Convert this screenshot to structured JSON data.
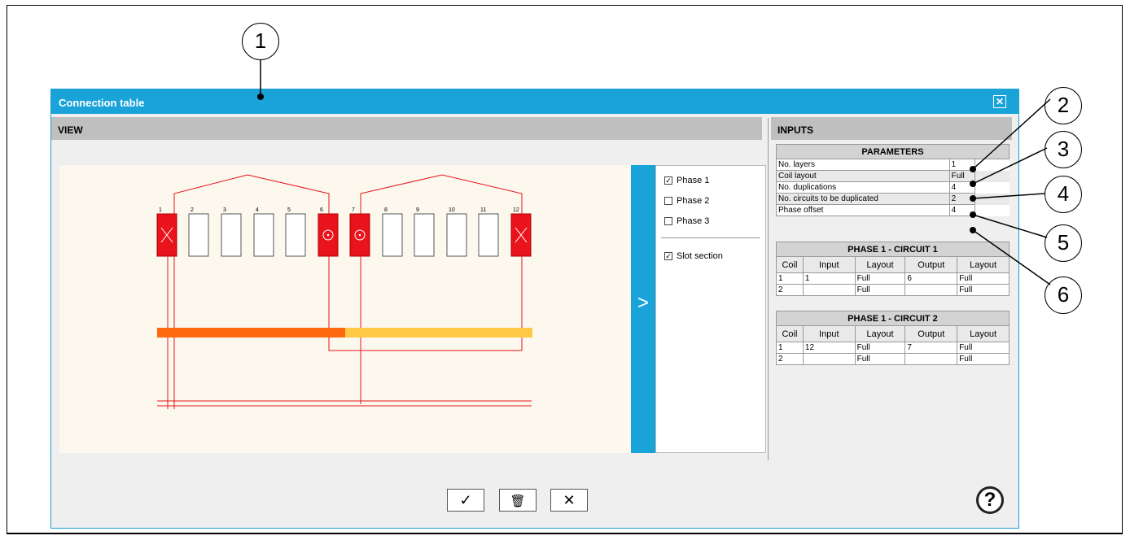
{
  "callouts": [
    "1",
    "2",
    "3",
    "4",
    "5",
    "6"
  ],
  "window": {
    "title": "Connection table",
    "close_icon": "close-box-icon"
  },
  "view": {
    "header": "VIEW",
    "slots": [
      "1",
      "2",
      "3",
      "4",
      "5",
      "6",
      "7",
      "8",
      "9",
      "10",
      "11",
      "12"
    ],
    "panel_toggle": ">",
    "options": [
      {
        "label": "Phase 1",
        "checked": true
      },
      {
        "label": "Phase 2",
        "checked": false
      },
      {
        "label": "Phase 3",
        "checked": false
      },
      {
        "label": "Slot section",
        "checked": true
      }
    ],
    "colors": {
      "slot_active": "#e8131b",
      "wire": "#e8131b",
      "bar_dark": "#ff6a10",
      "bar_light": "#ffc845",
      "canvas": "#fdf8ee"
    }
  },
  "inputs": {
    "header": "INPUTS",
    "parameters": {
      "caption": "PARAMETERS",
      "rows": [
        {
          "label": "No. layers",
          "value": "1"
        },
        {
          "label": "Coil layout",
          "value": "Full"
        },
        {
          "label": "No. duplications",
          "value": "4"
        },
        {
          "label": "No. circuits to be duplicated",
          "value": "2"
        },
        {
          "label": "Phase offset",
          "value": "4"
        }
      ]
    },
    "circuits": [
      {
        "caption": "PHASE 1 - CIRCUIT 1",
        "columns": [
          "Coil",
          "Input",
          "Layout",
          "Output",
          "Layout"
        ],
        "rows": [
          [
            "1",
            "1",
            "Full",
            "6",
            "Full"
          ],
          [
            "2",
            "",
            "Full",
            "",
            "Full"
          ]
        ]
      },
      {
        "caption": "PHASE 1 - CIRCUIT 2",
        "columns": [
          "Coil",
          "Input",
          "Layout",
          "Output",
          "Layout"
        ],
        "rows": [
          [
            "1",
            "12",
            "Full",
            "7",
            "Full"
          ],
          [
            "2",
            "",
            "Full",
            "",
            "Full"
          ]
        ]
      }
    ]
  },
  "buttons": {
    "validate": "✓",
    "delete": "🗑",
    "cancel": "✕",
    "help": "?"
  }
}
